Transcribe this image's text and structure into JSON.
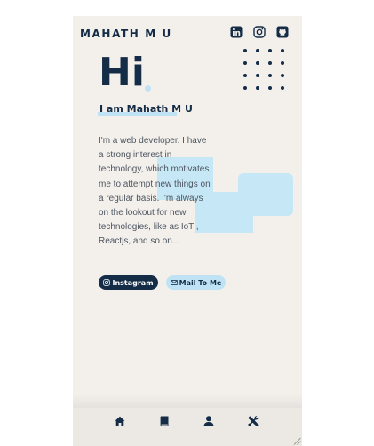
{
  "header": {
    "logo": "MAHATH M U",
    "social_icons": [
      "linkedin-icon",
      "instagram-icon",
      "github-icon"
    ]
  },
  "hero": {
    "greeting": "Hi",
    "intro": "I am Mahath M U",
    "description": "I'm a web developer. I have a strong interest in technology, which motivates me to attempt new things on a regular basis. I'm always on the lookout for new technologies, like as IoT , Reactjs, and so on...",
    "buttons": {
      "instagram": "Instagram",
      "mail": "Mail To Me"
    }
  },
  "bottom_nav": {
    "items": [
      "home-icon",
      "book-icon",
      "user-icon",
      "tools-icon"
    ]
  },
  "colors": {
    "navy": "#142c46",
    "accent": "#bfe3f5",
    "background": "#f3f0ec"
  }
}
